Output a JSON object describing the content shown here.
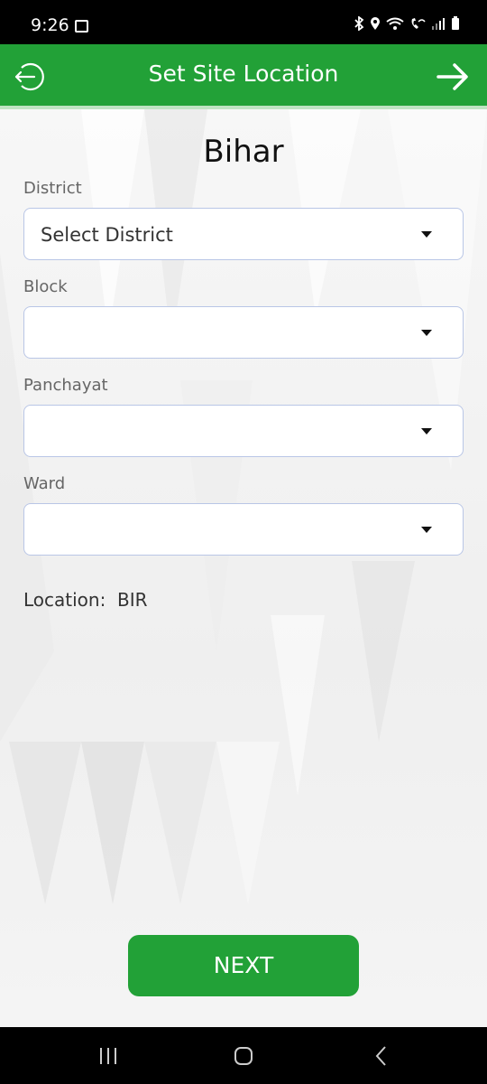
{
  "status_bar": {
    "time": "9:26",
    "icons": [
      "image-icon",
      "bluetooth-icon",
      "location-icon",
      "wifi-icon",
      "wifi-calling-icon",
      "signal-icon",
      "battery-icon"
    ]
  },
  "app_bar": {
    "title": "Set Site Location",
    "back_icon": "logout-back-icon",
    "forward_icon": "arrow-right-icon",
    "color": "#22a137"
  },
  "form": {
    "state": "Bihar",
    "fields": [
      {
        "label": "District",
        "value": "Select District"
      },
      {
        "label": "Block",
        "value": ""
      },
      {
        "label": "Panchayat",
        "value": ""
      },
      {
        "label": "Ward",
        "value": ""
      }
    ],
    "location_label": "Location:",
    "location_value": "BIR"
  },
  "next_button": {
    "label": "NEXT"
  },
  "nav_bar": {
    "icons": [
      "recent-apps-icon",
      "home-icon",
      "back-icon"
    ]
  }
}
